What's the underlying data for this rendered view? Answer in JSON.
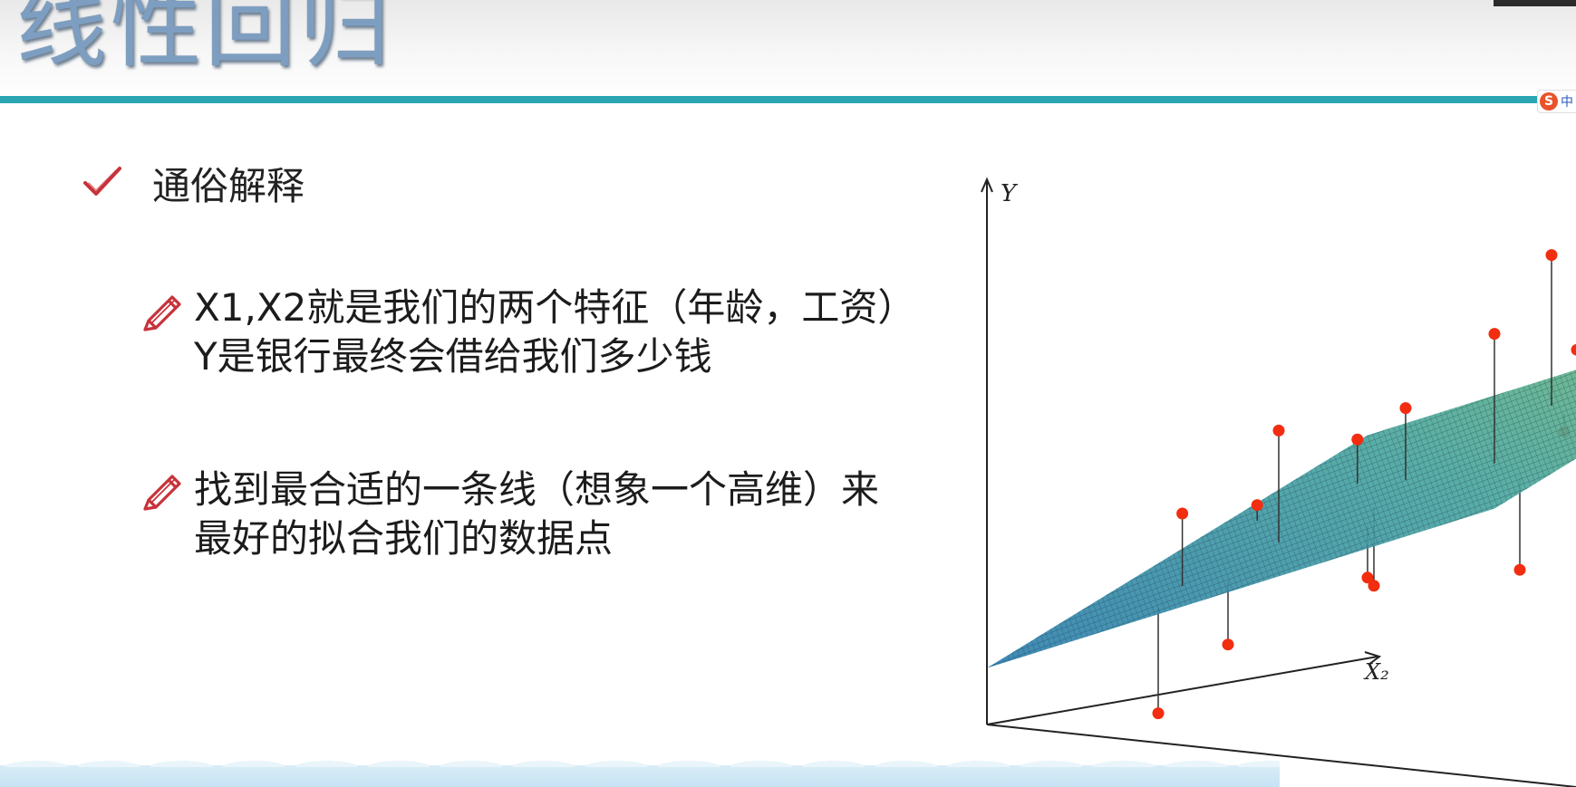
{
  "slide": {
    "title": "线性回归",
    "heading": "通俗解释",
    "bullets": [
      {
        "lines": [
          "X1,X2就是我们的两个特征（年龄，工资）",
          "Y是银行最终会借给我们多少钱"
        ]
      },
      {
        "lines": [
          "找到最合适的一条线（想象一个高维）来",
          "最好的拟合我们的数据点"
        ]
      }
    ]
  },
  "ime": {
    "label": "中"
  },
  "colors": {
    "title": "#7d9ec0",
    "rule": "#2aa6b2",
    "icon": "#c8323a",
    "point": "#f22d10",
    "plane_low": "#2f7fb0",
    "plane_high": "#7ec26e"
  },
  "icons": {
    "heading": "check-icon",
    "bullet": "pencil-icon"
  },
  "chart_data": {
    "type": "scatter",
    "title": "",
    "xlabel": "",
    "ylabel": "Y",
    "zlabel": "X2",
    "x_axis_label": "",
    "y_axis_label": "Y",
    "x2_axis_label": "X₂",
    "surface": "fitted regression plane",
    "grid": false,
    "legend": "none",
    "points": [
      {
        "x1": 0.25,
        "x2": 0.18,
        "y": 0.45
      },
      {
        "x1": 0.12,
        "x2": 0.55,
        "y": 0.4
      },
      {
        "x1": 0.28,
        "x2": 0.6,
        "y": 0.55
      },
      {
        "x1": 0.45,
        "x2": 0.5,
        "y": 0.65
      },
      {
        "x1": 0.35,
        "x2": 0.3,
        "y": 0.62
      },
      {
        "x1": 0.55,
        "x2": 0.75,
        "y": 0.95
      },
      {
        "x1": 0.7,
        "x2": 0.4,
        "y": 0.85
      },
      {
        "x1": 0.75,
        "x2": 0.55,
        "y": 0.8
      },
      {
        "x1": 0.8,
        "x2": 0.7,
        "y": 0.88
      },
      {
        "x1": 0.85,
        "x2": 0.8,
        "y": 0.7
      },
      {
        "x1": 0.9,
        "x2": 0.2,
        "y": 0.4
      },
      {
        "x1": 0.6,
        "x2": 0.2,
        "y": 0.35
      },
      {
        "x1": 0.4,
        "x2": 0.1,
        "y": 0.2
      },
      {
        "x1": 0.5,
        "x2": 0.35,
        "y": 0.3
      },
      {
        "x1": 0.3,
        "x2": 0.05,
        "y": 0.05
      },
      {
        "x1": 0.65,
        "x2": 0.65,
        "y": 0.6
      }
    ]
  }
}
